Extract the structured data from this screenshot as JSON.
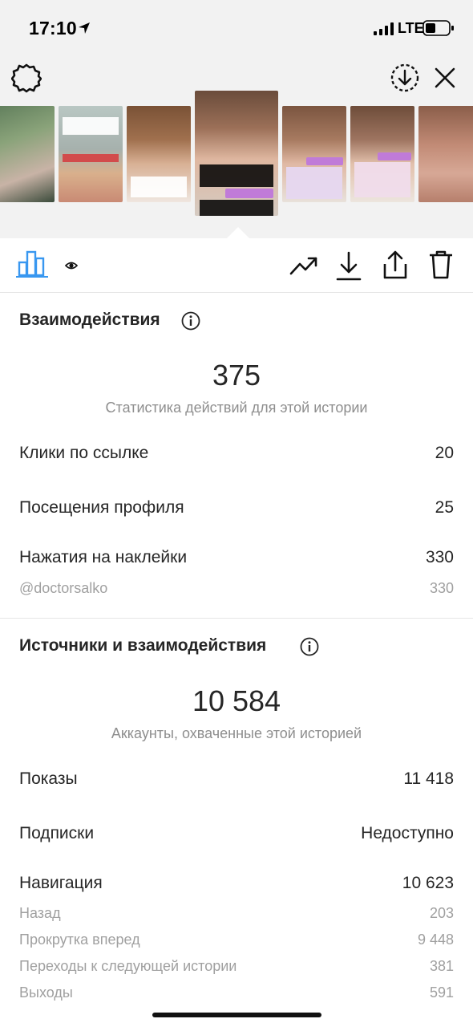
{
  "status_bar": {
    "time": "17:10",
    "network": "LTE"
  },
  "top_controls": {
    "settings_icon": "gear-icon",
    "save_icon": "download-circle-icon",
    "close_icon": "close-icon"
  },
  "toolbar": {
    "icons": [
      "bar-chart-icon",
      "eye-icon",
      "trending-icon",
      "download-icon",
      "share-icon",
      "trash-icon"
    ]
  },
  "interactions": {
    "title": "Взаимодействия",
    "total": "375",
    "caption": "Статистика действий для этой истории",
    "rows": [
      {
        "label": "Клики по ссылке",
        "value": "20"
      },
      {
        "label": "Посещения профиля",
        "value": "25"
      },
      {
        "label": "Нажатия на наклейки",
        "value": "330"
      }
    ],
    "sub_rows": [
      {
        "label": "@doctorsalko",
        "value": "330"
      }
    ]
  },
  "discovery": {
    "title": "Источники и взаимодействия",
    "total": "10 584",
    "caption": "Аккаунты, охваченные этой историей",
    "rows": [
      {
        "label": "Показы",
        "value": "11 418"
      },
      {
        "label": "Подписки",
        "value": "Недоступно"
      },
      {
        "label": "Навигация",
        "value": "10 623"
      }
    ],
    "sub_rows": [
      {
        "label": "Назад",
        "value": "203"
      },
      {
        "label": "Прокрутка вперед",
        "value": "9 448"
      },
      {
        "label": "Переходы к следующей истории",
        "value": "381"
      },
      {
        "label": "Выходы",
        "value": "591"
      }
    ]
  },
  "colors": {
    "accent": "#3897f0",
    "text": "#262626",
    "muted": "#8e8e8e"
  }
}
